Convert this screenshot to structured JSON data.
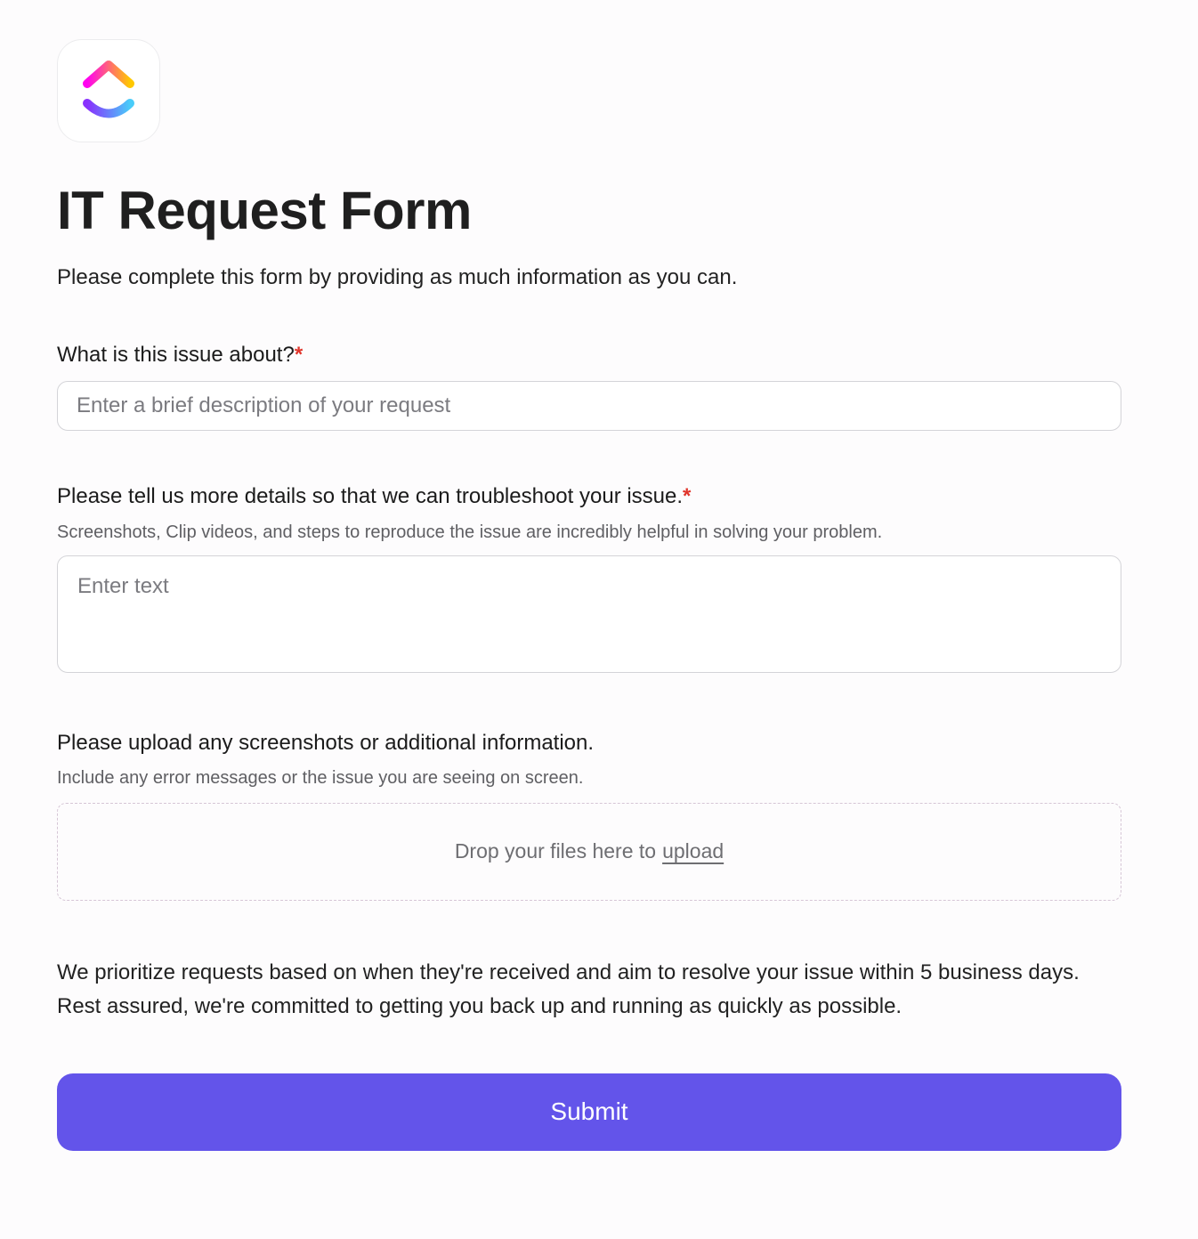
{
  "form": {
    "title": "IT Request Form",
    "subtitle": "Please complete this form by providing as much information as you can.",
    "accent_color": "#6354ea",
    "required_marker": "*",
    "logo": "clickup-logo"
  },
  "fields": [
    {
      "label": "What is this issue about?",
      "required": true,
      "placeholder": "Enter a brief description of your request",
      "value": ""
    },
    {
      "label": "Please tell us more details so that we can troubleshoot your issue.",
      "required": true,
      "help": "Screenshots, Clip videos, and steps to reproduce the issue are incredibly helpful in solving your problem.",
      "placeholder": "Enter text",
      "value": ""
    },
    {
      "label": "Please upload any screenshots or additional information.",
      "required": false,
      "help": "Include any error messages or the issue you are seeing on screen.",
      "dropzone_text": "Drop your files here to",
      "upload_link": "upload"
    }
  ],
  "note": "We prioritize requests based on when they're received and aim to resolve your issue within 5 business days. Rest assured, we're committed to getting you back up and running as quickly as possible.",
  "submit_label": "Submit"
}
